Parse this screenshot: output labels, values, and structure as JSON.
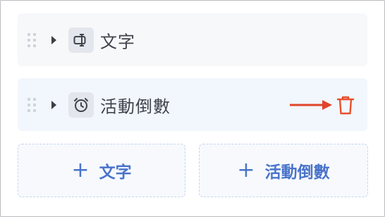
{
  "items": [
    {
      "label": "文字",
      "icon": "text-field-icon"
    },
    {
      "label": "活動倒數",
      "icon": "alarm-clock-icon"
    }
  ],
  "annotation": {
    "icon": "red-arrow-pointing-right"
  },
  "actions": {
    "delete_icon": "trash-icon",
    "delete_color": "#e8502e"
  },
  "add_buttons": [
    {
      "label": "文字",
      "plus": "+"
    },
    {
      "label": "活動倒數",
      "plus": "+"
    }
  ],
  "colors": {
    "accent": "#4a74c9",
    "annotation_red": "#e0442a"
  }
}
